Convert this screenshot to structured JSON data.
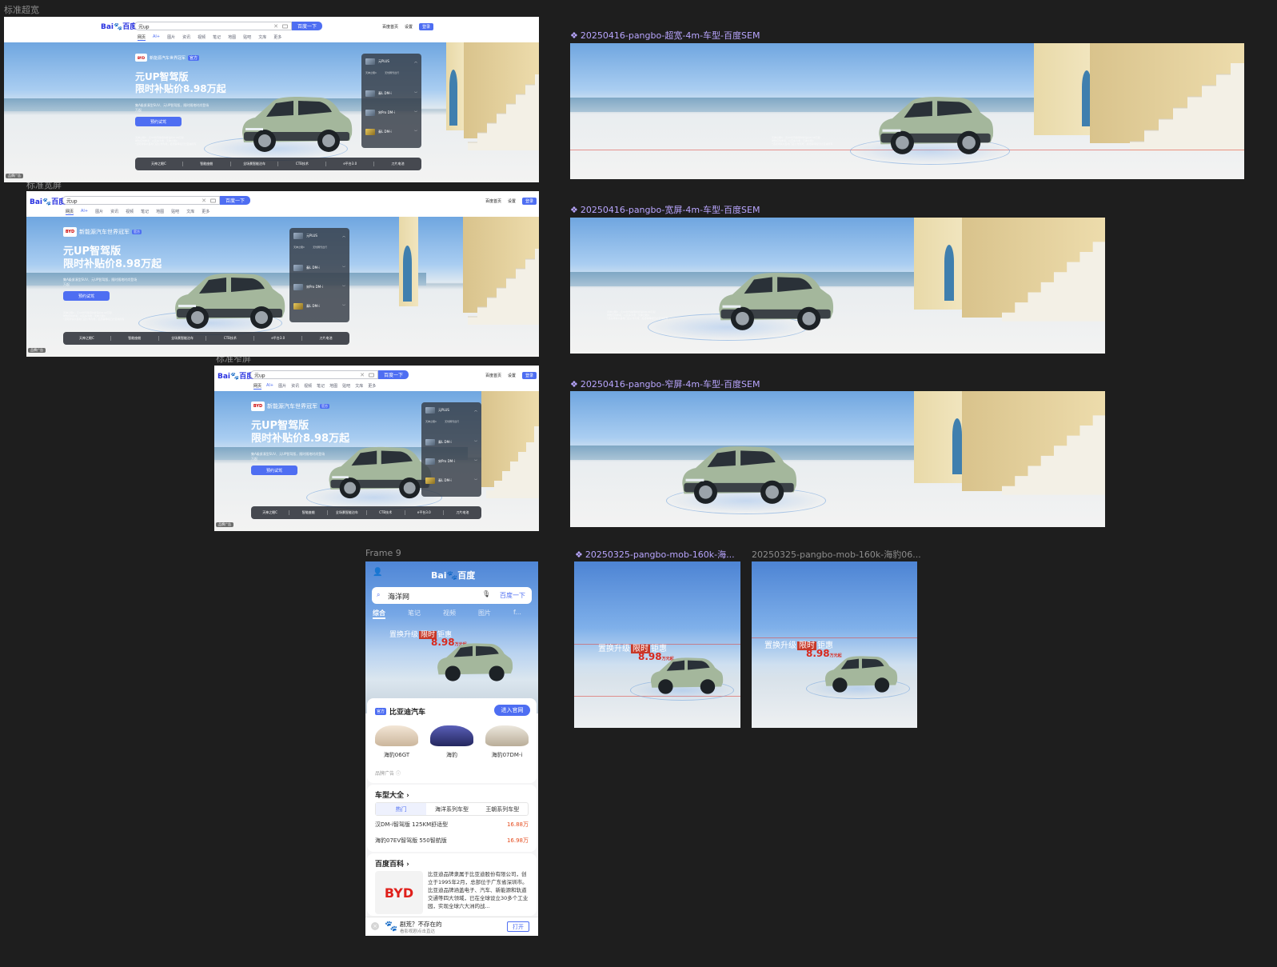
{
  "labels": {
    "frame1": "标准超宽",
    "frame2": "标准宽屏",
    "frame3": "标准窄屏",
    "frame9": "Frame 9",
    "comp1": "20250416-pangbo-超宽-4m-车型-百度SEM",
    "comp2": "20250416-pangbo-宽屏-4m-车型-百度SEM",
    "comp3": "20250416-pangbo-窄屏-4m-车型-百度SEM",
    "mob1": "20250325-pangbo-mob-160k-海...",
    "mob2": "20250325-pangbo-mob-160k-海豹06..."
  },
  "serp": {
    "logo_bai": "Bai",
    "logo_du": "百度",
    "query": "元up",
    "search_button": "百度一下",
    "tabs": [
      "网页",
      "AI+",
      "图片",
      "资讯",
      "视频",
      "笔记",
      "地图",
      "贴吧",
      "文库",
      "更多"
    ],
    "toplinks": [
      "百度首页",
      "设置"
    ],
    "login": "登录",
    "ad_label": "品牌广告"
  },
  "ad": {
    "brand_logo": "BYD",
    "brand": "新能源汽车世界冠军",
    "brand_tag": "官方",
    "title_line1": "元UP智驾版",
    "title_line2": "限时补贴价8.98万起",
    "subtitle": "集A级紧凑型SUV、元UP智驾版，随时随地时尚登场",
    "subtitle2": "万起",
    "cta": "预约试驾",
    "fine_print": [
      "天神之眼C  · 元UP智驾版限时补贴价8.98万起",
      "参数仅供参考，以实车为准  · 天神之眼C",
      "*活动详情以各地门店公布为准，最终解释权归比亚迪所有"
    ],
    "models": [
      {
        "name": "元PLUS",
        "desc1": "天神之眼C",
        "desc2": "无忧畅驾出行"
      },
      {
        "name": "秦L DM-i"
      },
      {
        "name": "宋Pro DM-i"
      },
      {
        "name": "秦L DM-i"
      }
    ],
    "model_top_name_narrow": "元PLUS",
    "features": [
      "天神之眼C",
      "智能座舱",
      "全场景智能泊车",
      "CTB技术",
      "e平台3.0",
      "刀片电池"
    ]
  },
  "mobile": {
    "logo": "百度",
    "logo_sub": "Bai",
    "query": "海洋网",
    "search_button": "百度一下",
    "tabs": [
      "综合",
      "笔记",
      "视频",
      "图片",
      "f..."
    ],
    "hero_line1": "置换升级",
    "hero_tag": "限时",
    "hero_line1b": "钜惠",
    "hero_price": "8.98",
    "hero_unit": "万元起",
    "brand_tag": "官方",
    "brand_name": "比亚迪汽车",
    "brand_cta": "进入官网",
    "cars": [
      "海豹06GT",
      "海豹",
      "海豹07DM-i"
    ],
    "ad_label": "品牌广告",
    "section1": "车型大全",
    "seg": [
      "热门",
      "海洋系列车型",
      "王朝系列车型"
    ],
    "prices": [
      {
        "name": "汉DM-i智驾版 125KM舒适型",
        "price": "16.88万"
      },
      {
        "name": "海豹07EV智驾版 550智航版",
        "price": "16.98万"
      }
    ],
    "section2": "百度百科",
    "baike_logo": "BYD",
    "baike_text": "比亚迪品牌隶属于比亚迪股份有限公司，创立于1995年2月，总部位于广东省深圳市。比亚迪品牌涵盖电子、汽车、新能源和轨道交通等四大领域，已在全球设立30多个工业园，实现全球六大洲的战...",
    "bottom_title": "剧荒？不存在的",
    "bottom_sub": "看影视剧点击直达",
    "bottom_open": "打开"
  },
  "banner_hero": {
    "line1": "置换升级",
    "tag": "限时",
    "line1b": "钜惠",
    "price": "8.98",
    "unit": "万元起"
  },
  "colors": {
    "baidu_blue": "#4e6ef2",
    "baidu_red": "#e10602",
    "label_purple": "#b9a6ff",
    "price_orange": "#e54b1d",
    "canvas_bg": "#1e1e1e"
  }
}
